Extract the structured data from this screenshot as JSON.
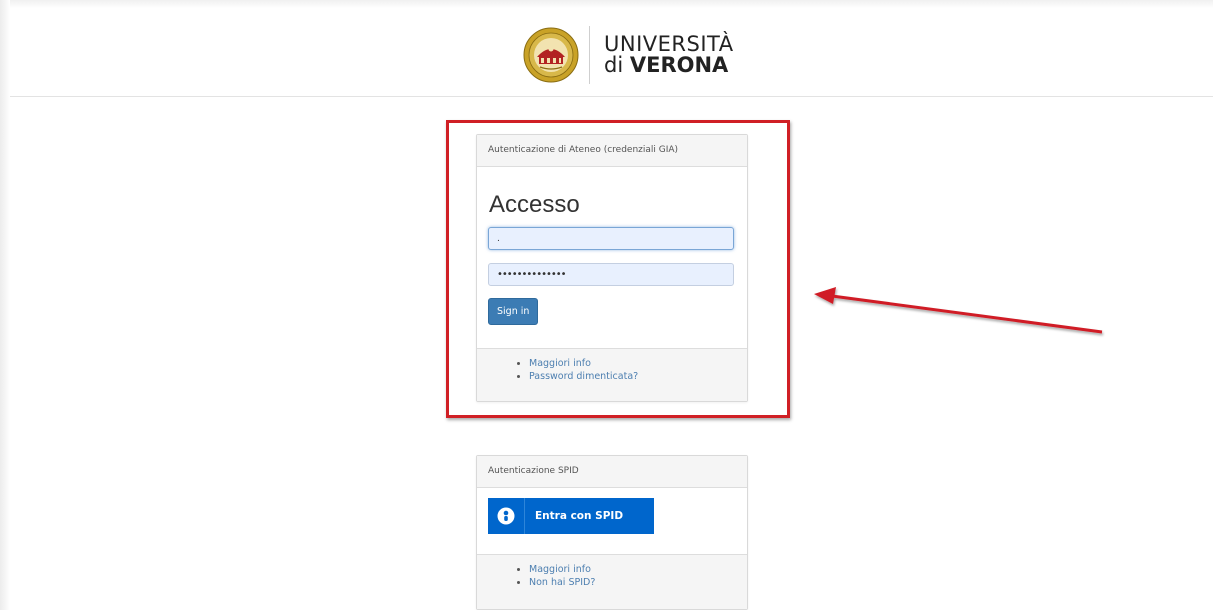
{
  "header": {
    "logo_line1": "UNIVERSITÀ",
    "logo_di": "di",
    "logo_verona": "VERONA"
  },
  "login_panel": {
    "heading": "Autenticazione di Ateneo (credenziali GIA)",
    "title": "Accesso",
    "username_value": ".",
    "password_value": "••••••••••••••",
    "signin_label": "Sign in",
    "links": [
      "Maggiori info",
      "Password dimenticata?"
    ]
  },
  "spid_panel": {
    "heading": "Autenticazione SPID",
    "button_label": "Entra con SPID",
    "links": [
      "Maggiori info",
      "Non hai SPID?"
    ]
  },
  "colors": {
    "accent_blue": "#3c7cb4",
    "spid_blue": "#0066cc",
    "annotation_red": "#d01f25"
  },
  "icons": [
    "university-seal-icon",
    "spid-person-icon",
    "annotation-arrow"
  ]
}
